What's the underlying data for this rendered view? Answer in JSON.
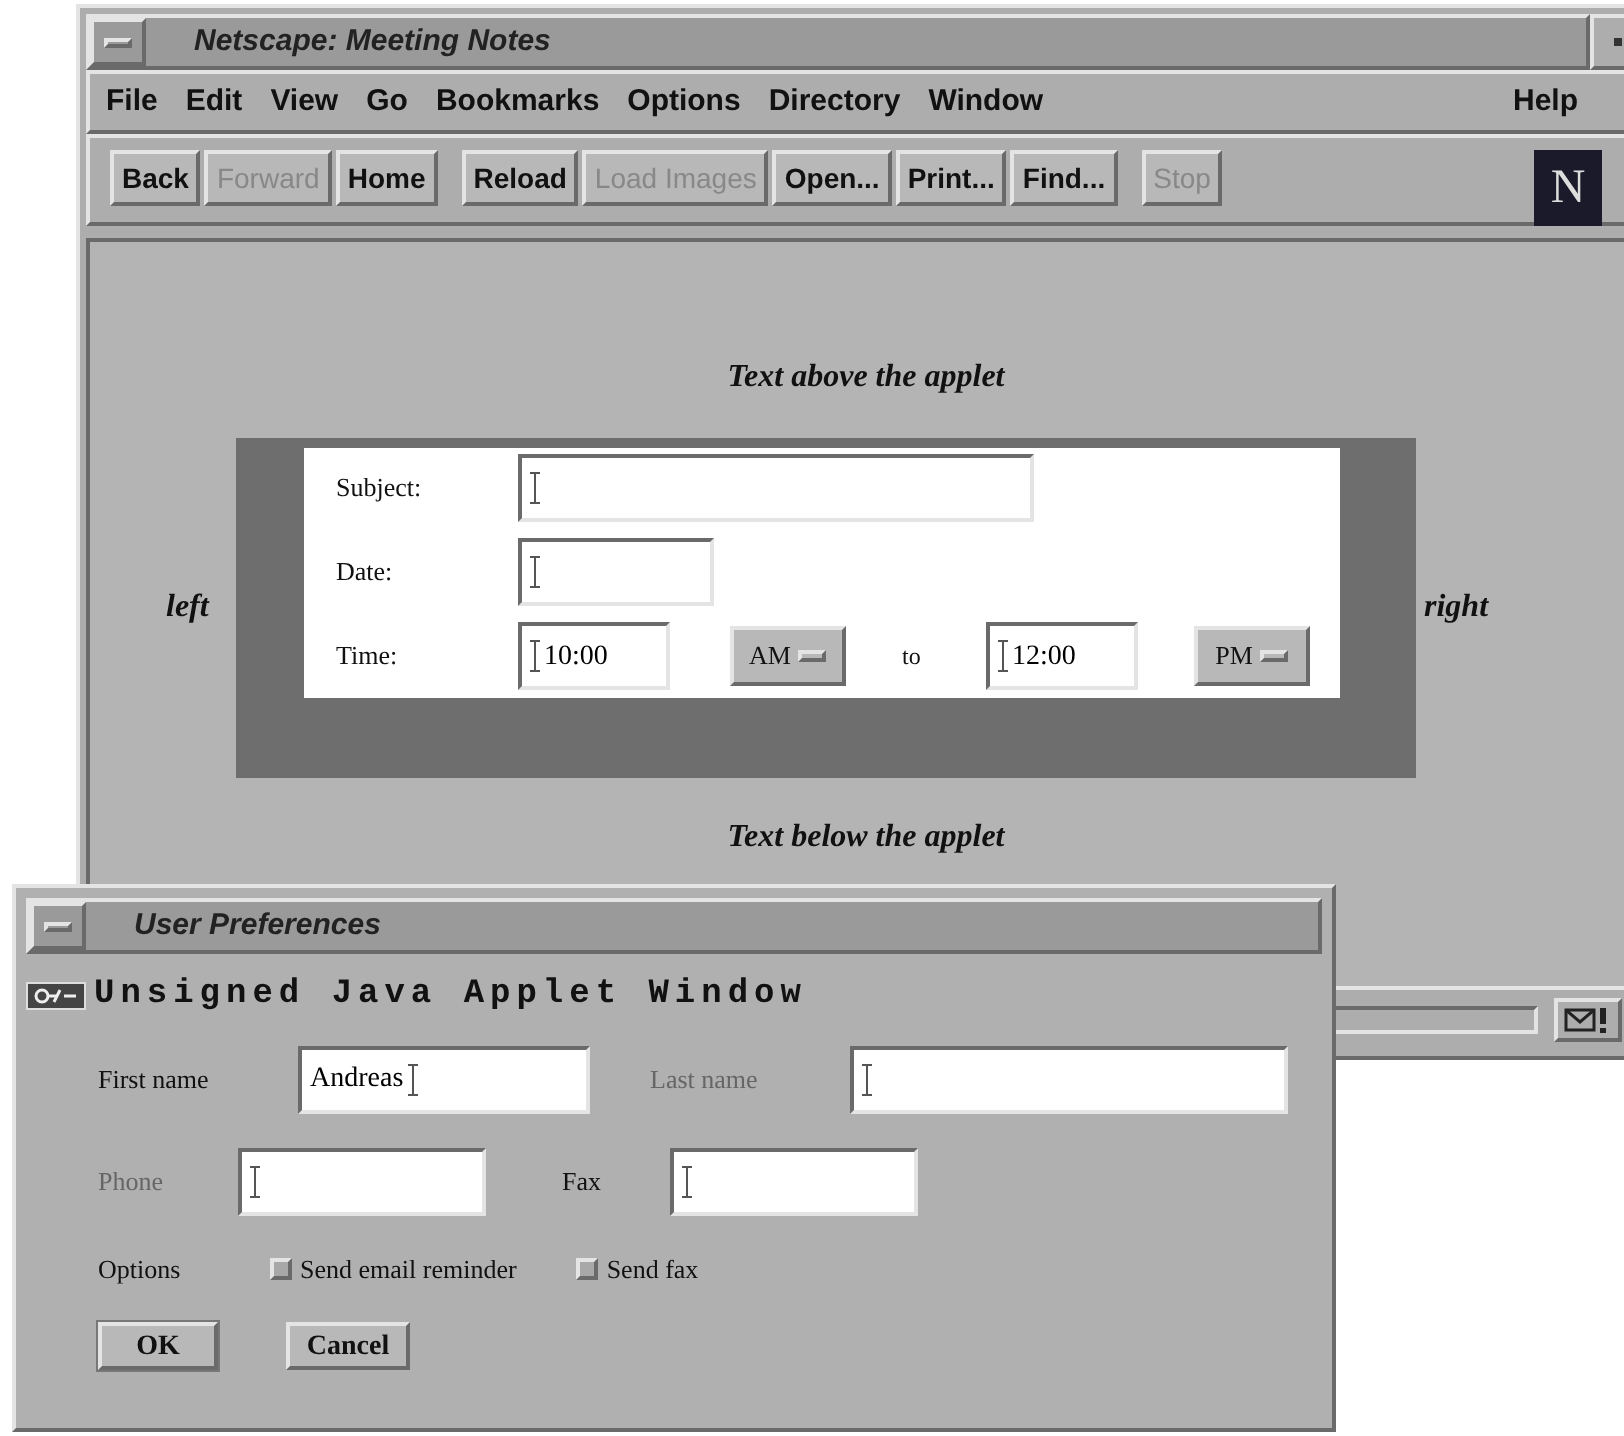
{
  "browser": {
    "title": "Netscape: Meeting Notes",
    "menu": [
      {
        "label": "File"
      },
      {
        "label": "Edit"
      },
      {
        "label": "View"
      },
      {
        "label": "Go"
      },
      {
        "label": "Bookmarks"
      },
      {
        "label": "Options"
      },
      {
        "label": "Directory"
      },
      {
        "label": "Window"
      }
    ],
    "help": "Help",
    "toolbar": [
      {
        "label": "Back",
        "disabled": false
      },
      {
        "label": "Forward",
        "disabled": true
      },
      {
        "label": "Home",
        "disabled": false
      },
      {
        "label": "Reload",
        "disabled": false
      },
      {
        "label": "Load Images",
        "disabled": true
      },
      {
        "label": "Open...",
        "disabled": false
      },
      {
        "label": "Print...",
        "disabled": false
      },
      {
        "label": "Find...",
        "disabled": false
      },
      {
        "label": "Stop",
        "disabled": true
      }
    ],
    "logo": "N",
    "page": {
      "above": "Text above the applet",
      "left": "left",
      "right": "right",
      "below": "Text below the applet",
      "applet": {
        "subject": {
          "label": "Subject:"
        },
        "date": {
          "label": "Date:"
        },
        "time": {
          "label": "Time:",
          "start": "10:00",
          "start_period": "AM",
          "to": "to",
          "end": "12:00",
          "end_period": "PM"
        }
      }
    }
  },
  "dialog": {
    "title": "User Preferences",
    "warning": "Unsigned Java Applet Window",
    "fields": [
      {
        "label": "First name",
        "value": "Andreas",
        "disabled": false
      },
      {
        "label": "Last name",
        "disabled": true
      },
      {
        "label": "Phone",
        "disabled": true
      },
      {
        "label": "Fax",
        "disabled": false
      }
    ],
    "options_label": "Options",
    "options": [
      {
        "label": "Send email reminder",
        "checked": false
      },
      {
        "label": "Send fax",
        "checked": false
      }
    ],
    "buttons": [
      {
        "label": "OK",
        "default": true
      },
      {
        "label": "Cancel",
        "default": false
      }
    ]
  }
}
